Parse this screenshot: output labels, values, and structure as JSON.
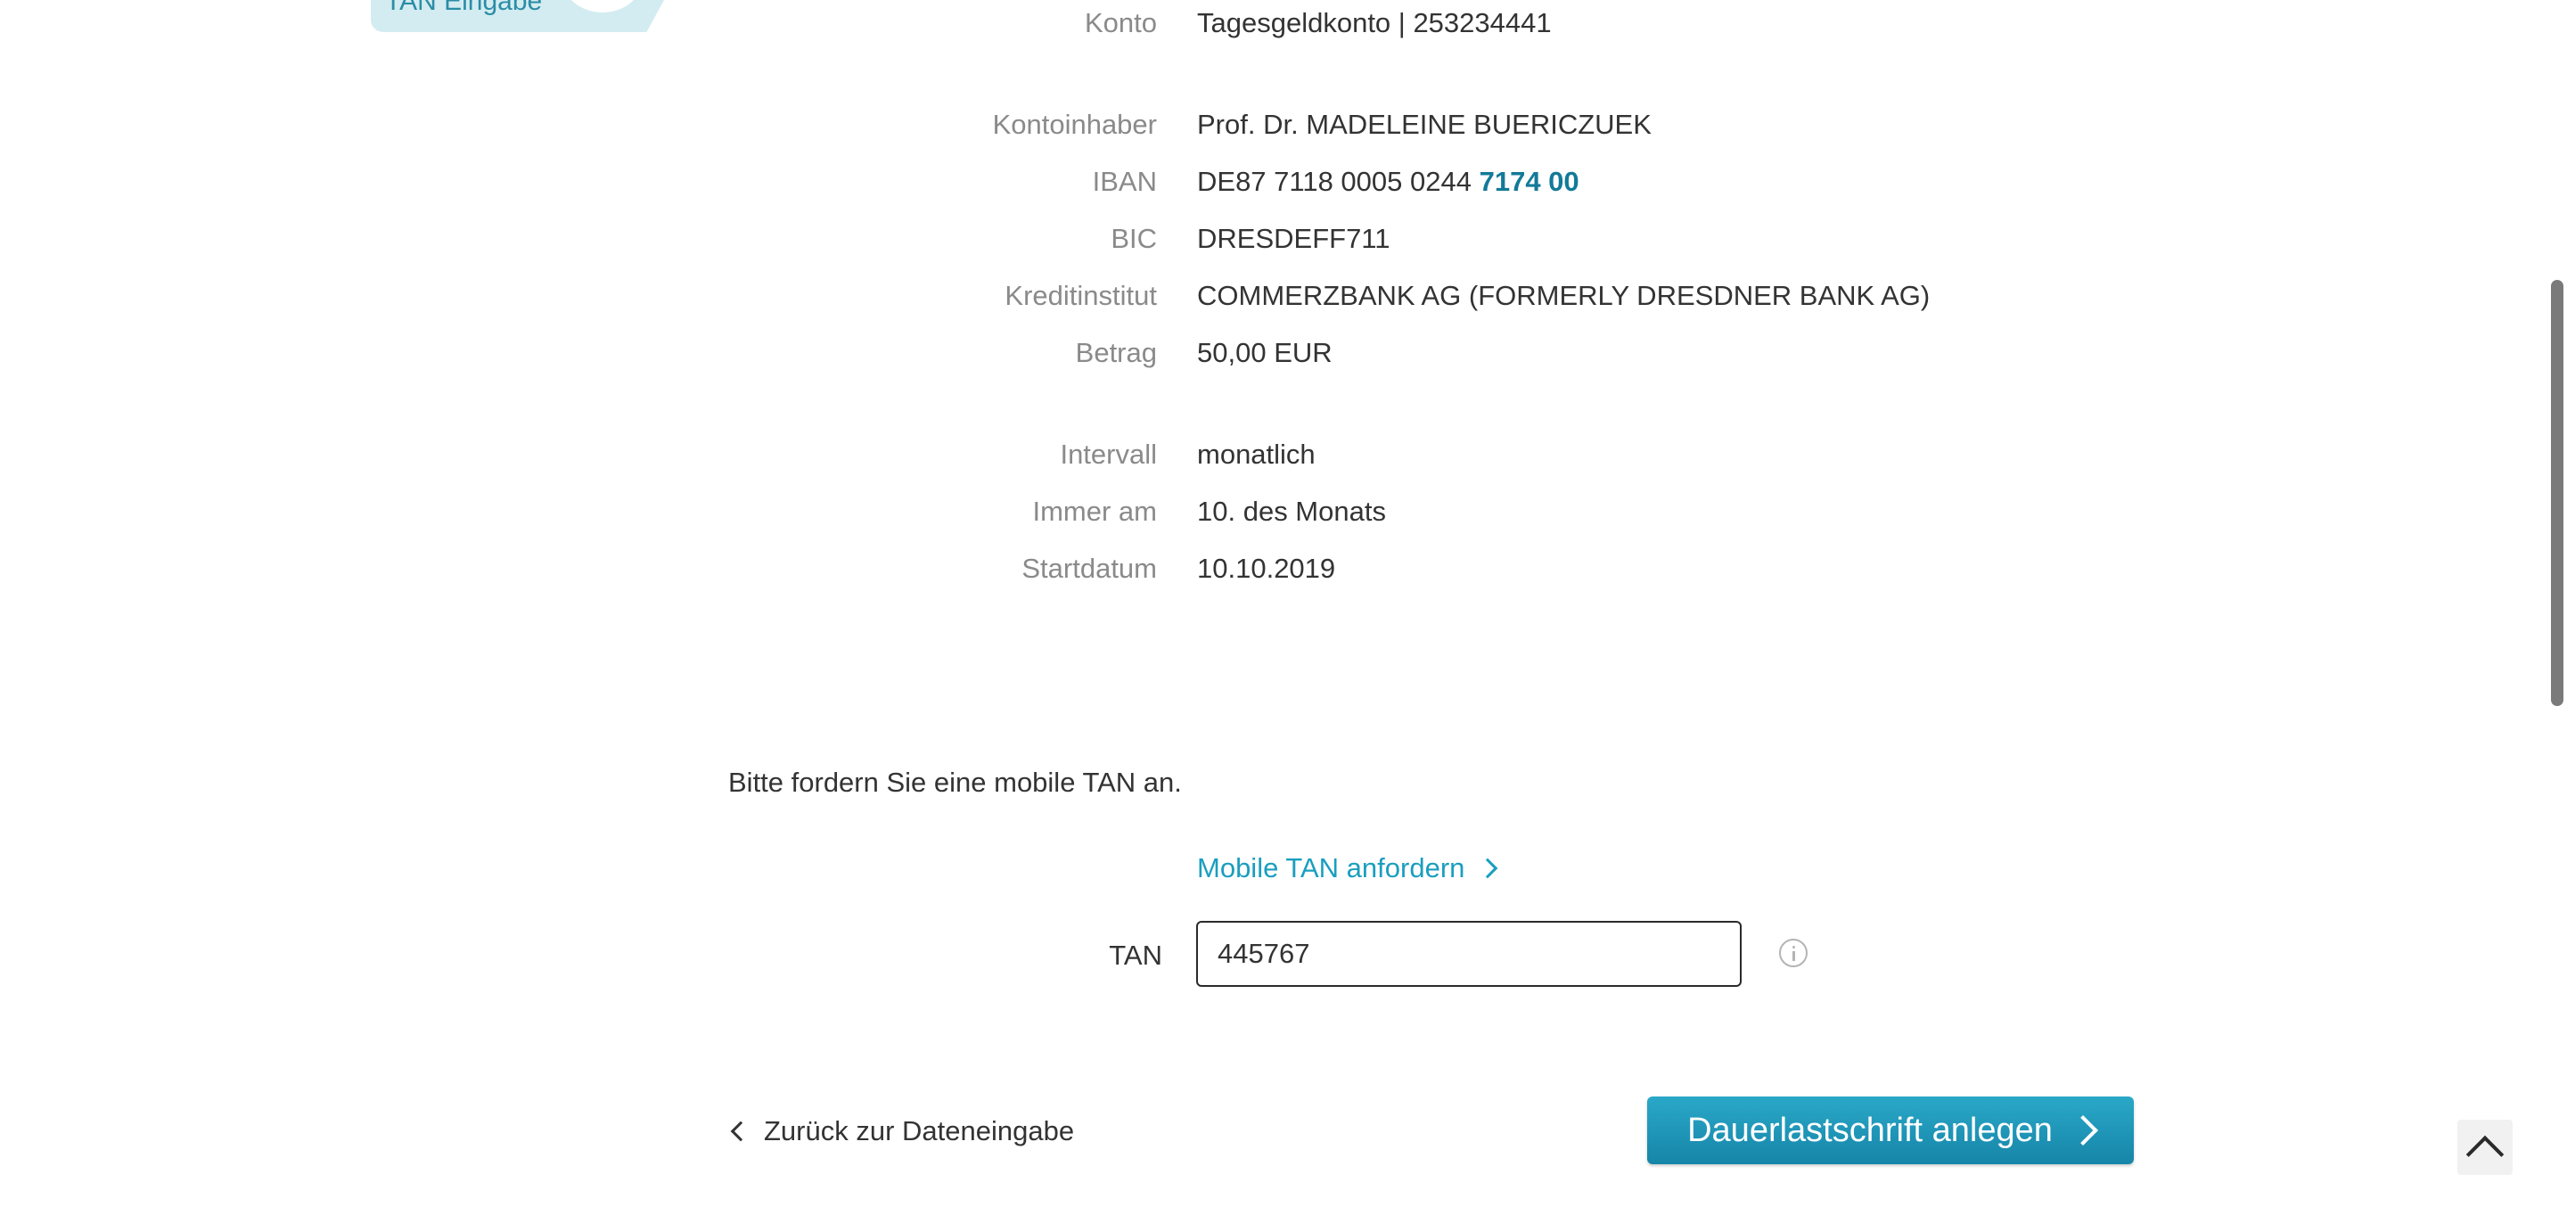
{
  "steps": {
    "current_step_label": "TAN Eingabe"
  },
  "summary": {
    "rows": [
      {
        "label": "Konto",
        "value": "Tagesgeldkonto | 253234441"
      },
      {
        "label": "Kontoinhaber",
        "value": "Prof. Dr. MADELEINE BUERICZUEK"
      },
      {
        "label": "IBAN",
        "value_prefix": "DE87 7118 0005 0244",
        "value_highlight": "7174 00"
      },
      {
        "label": "BIC",
        "value": "DRESDEFF711"
      },
      {
        "label": "Kreditinstitut",
        "value": "COMMERZBANK AG (FORMERLY DRESDNER BANK AG)"
      },
      {
        "label": "Betrag",
        "value": "50,00 EUR"
      },
      {
        "label": "Intervall",
        "value": "monatlich"
      },
      {
        "label": "Immer am",
        "value": "10. des Monats"
      },
      {
        "label": "Startdatum",
        "value": "10.10.2019"
      }
    ]
  },
  "tan": {
    "prompt": "Bitte fordern Sie eine mobile TAN an.",
    "request_link": "Mobile TAN anfordern",
    "label": "TAN",
    "value": "445767"
  },
  "actions": {
    "back_label": "Zurück zur Dateneingabe",
    "submit_label": "Dauerlastschrift anlegen"
  },
  "icons": {
    "info": "info-icon",
    "scroll_top": "chevron-up-icon",
    "back": "chevron-left-icon",
    "forward": "chevron-right-icon"
  },
  "colors": {
    "accent": "#1a9ebf",
    "button_top": "#2aa8c8",
    "button_bottom": "#1685a8",
    "label_gray": "#8a8a8a",
    "text_dark": "#333333",
    "step_tab_bg": "#d3ecf1"
  }
}
